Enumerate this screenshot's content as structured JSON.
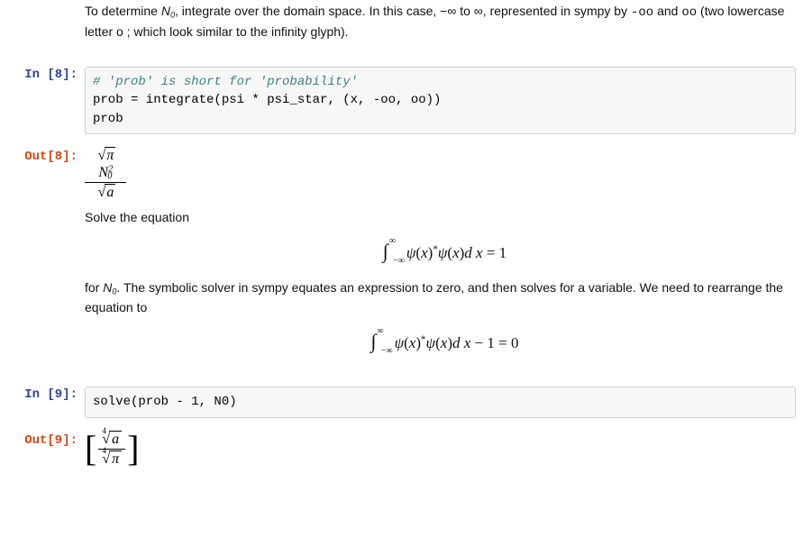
{
  "md1": {
    "line1_pre": "To determine ",
    "n0": "N",
    "n0sub": "0",
    "line1_mid": ", integrate over the domain space. In this case, −∞ to ∞, represented in sympy by ",
    "neg_oo": "-oo",
    "and": " and ",
    "pos_oo": "oo",
    "line1_post": " (two lowercase letter o ; which look similar to the infinity glyph)."
  },
  "cell8": {
    "prompt_in": "In [8]:",
    "code_comment": "# 'prob' is short for 'probability'",
    "code_line1": "prob = integrate(psi * psi_star, (x, -oo, oo))",
    "code_line2": "prob",
    "prompt_out": "Out[8]:",
    "out_num_pi": "π",
    "out_num_N": "N",
    "out_num_Nsup": "2",
    "out_num_Nsub": "0",
    "out_den_a": "a"
  },
  "md2": {
    "p1": "Solve the equation",
    "eq1_psi": "ψ",
    "eq1_x": "x",
    "eq1_star": "*",
    "eq1_dx": "d x",
    "eq1_rhs": " = 1",
    "p2_pre": "for ",
    "n0": "N",
    "n0sub": "0",
    "p2_post": ". The symbolic solver in sympy equates an expression to zero, and then solves for a variable. We need to rearrange the equation to",
    "eq2_rhs": " − 1 = 0",
    "inf": "∞",
    "neg_inf": "−∞"
  },
  "cell9": {
    "prompt_in": "In [9]:",
    "code_line1": "solve(prob - 1, N0)",
    "prompt_out": "Out[9]:",
    "idx4": "4",
    "num_a": "a",
    "den_pi": "π"
  }
}
